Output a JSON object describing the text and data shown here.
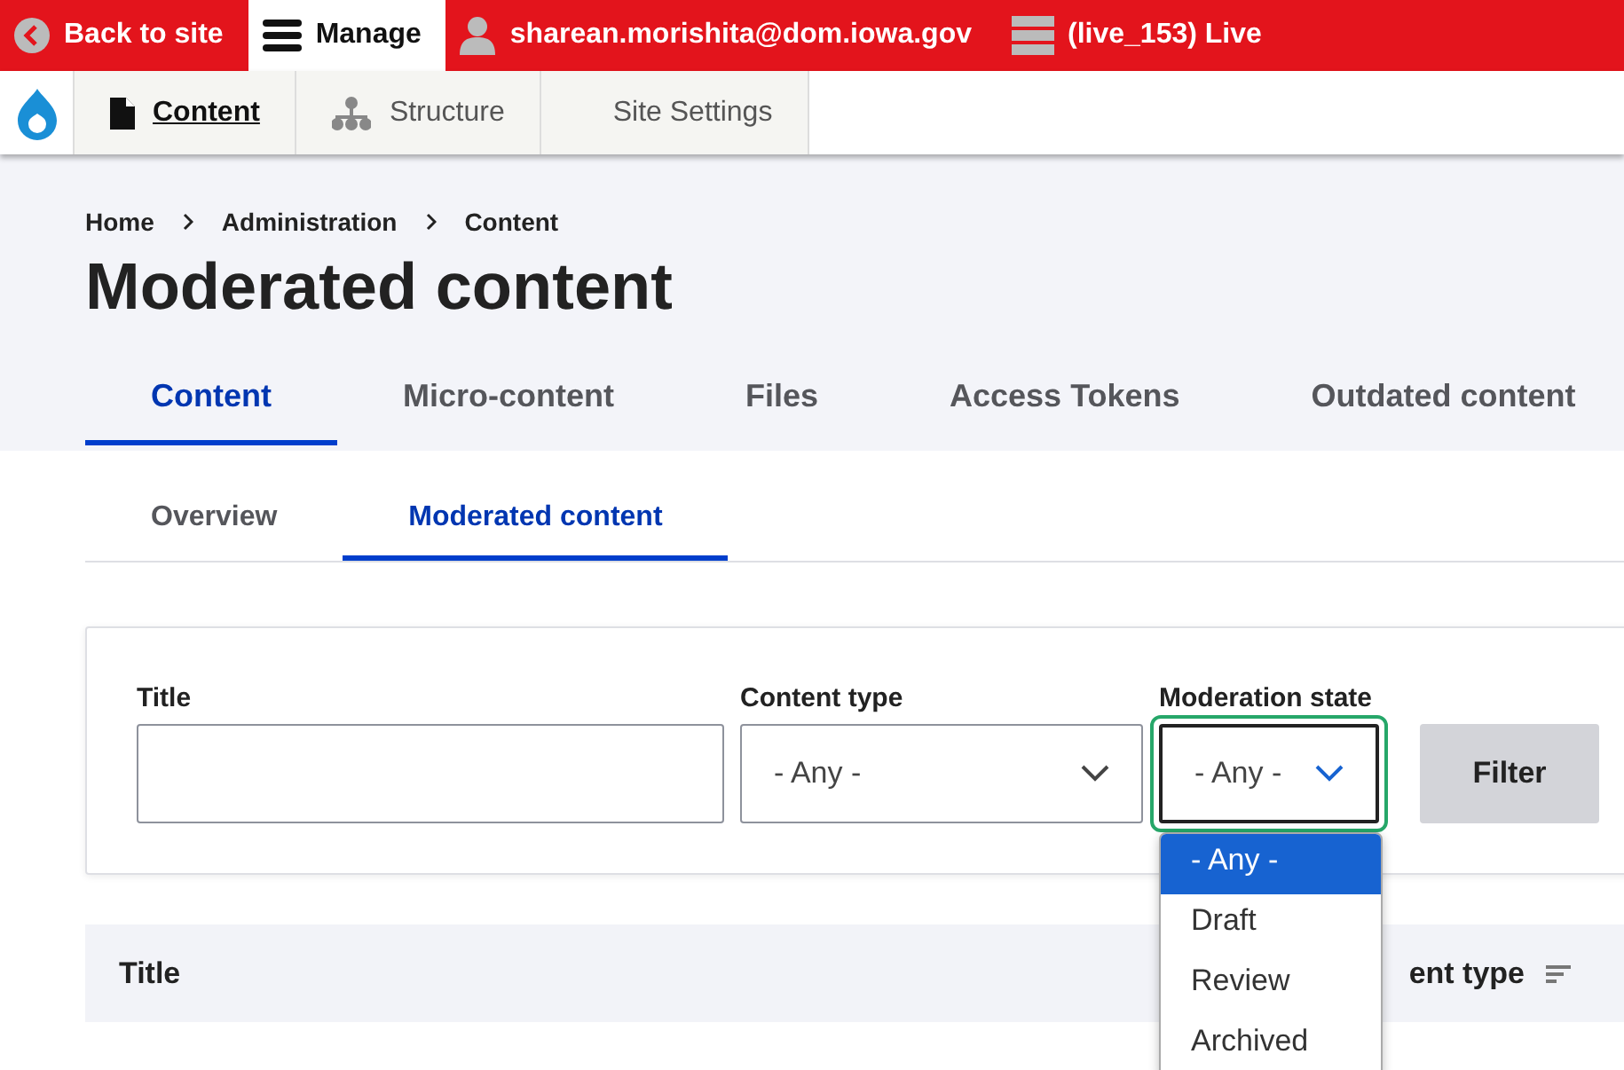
{
  "toolbar": {
    "items": [
      {
        "kind": "back",
        "label": "Back to site",
        "selected": false
      },
      {
        "kind": "manage",
        "label": "Manage",
        "selected": true
      },
      {
        "kind": "user",
        "label": "sharean.morishita@dom.iowa.gov",
        "selected": false
      },
      {
        "kind": "server",
        "label": "(live_153) Live",
        "selected": false
      }
    ]
  },
  "admin_menu": {
    "items": [
      {
        "kind": "content",
        "label": "Content",
        "selected": true
      },
      {
        "kind": "structure",
        "label": "Structure",
        "selected": false
      },
      {
        "kind": "settings",
        "label": "Site Settings",
        "selected": false
      }
    ]
  },
  "breadcrumb": [
    "Home",
    "Administration",
    "Content"
  ],
  "page_title": "Moderated content",
  "primary_tabs": [
    {
      "label": "Content",
      "selected": true
    },
    {
      "label": "Micro-content",
      "selected": false
    },
    {
      "label": "Files",
      "selected": false
    },
    {
      "label": "Access Tokens",
      "selected": false
    },
    {
      "label": "Outdated content",
      "selected": false
    }
  ],
  "secondary_tabs": [
    {
      "label": "Overview",
      "selected": false
    },
    {
      "label": "Moderated content",
      "selected": true
    }
  ],
  "filters": [
    {
      "kind": "text",
      "label": "Title"
    },
    {
      "kind": "select",
      "label": "Content type",
      "value": "- Any -",
      "expanded": false
    },
    {
      "kind": "select",
      "label": "Moderation state",
      "value": "- Any -",
      "expanded": true,
      "options": [
        {
          "label": "- Any -",
          "selected": true
        },
        {
          "label": "Draft",
          "selected": false
        },
        {
          "label": "Review",
          "selected": false
        },
        {
          "label": "Archived",
          "selected": false
        }
      ]
    }
  ],
  "filter_button": "Filter",
  "table": {
    "columns": [
      {
        "label": "Title"
      },
      {
        "label": "ent type"
      }
    ]
  }
}
